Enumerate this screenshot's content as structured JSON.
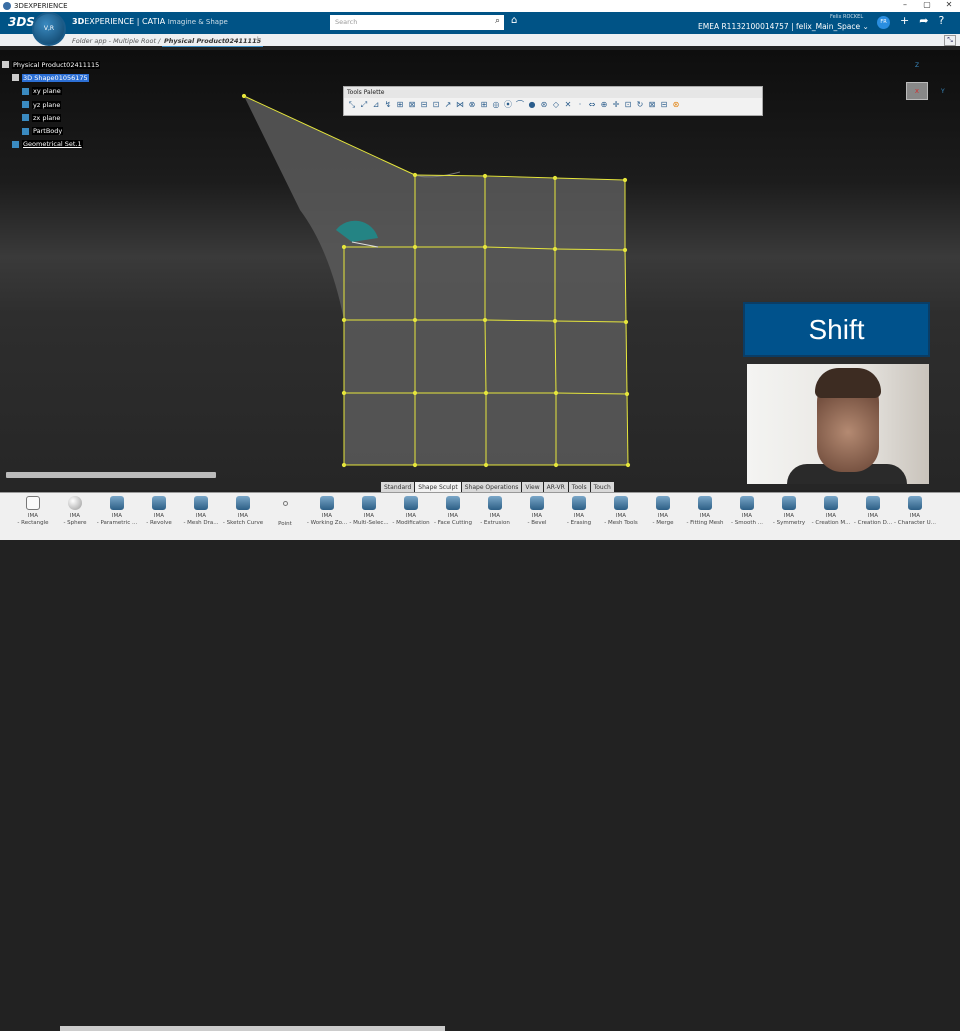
{
  "window": {
    "title": "3DEXPERIENCE",
    "controls": [
      "–",
      "▢",
      "✕"
    ]
  },
  "topbar": {
    "ds_logo": "3DS",
    "compass": "V,R",
    "brand_bold": "3D",
    "brand_rest": "EXPERIENCE | CATIA",
    "app": "Imagine & Shape",
    "search_placeholder": "Search",
    "user_name": "Felix ROCKEL",
    "context": "EMEA R1132100014757 | felix_Main_Space ⌄",
    "avatar": "FR"
  },
  "tabbar": {
    "breadcrumb": "Folder app - Multiple Root /",
    "active_tab": "Physical Product02411115"
  },
  "tree": [
    {
      "label": "Physical Product02411115",
      "icon": "product-icon"
    },
    {
      "label": "3D Shape01056175",
      "icon": "shape-icon",
      "selected": true
    },
    {
      "label": "xy plane",
      "icon": "plane-icon"
    },
    {
      "label": "yz plane",
      "icon": "plane-icon"
    },
    {
      "label": "zx plane",
      "icon": "plane-icon"
    },
    {
      "label": "PartBody",
      "icon": "partbody-icon"
    },
    {
      "label": "Geometrical Set.1",
      "icon": "geoset-icon"
    }
  ],
  "palette": {
    "title": "Tools Palette",
    "icons": [
      "⤡",
      "⤢",
      "⊿",
      "↯",
      "⊞",
      "⊠",
      "⊟",
      "⊡",
      "↗",
      "⋈",
      "⊗",
      "⊞",
      "◎",
      "⦿",
      "⌒",
      "●",
      "⊛",
      "◇",
      "✕",
      "·",
      "⇔",
      "⊕",
      "✛",
      "⊡",
      "↻",
      "⊠",
      "⊟",
      "⊛"
    ]
  },
  "axis": {
    "z": "Z",
    "y": "Y",
    "x": "x"
  },
  "overlay": {
    "key": "Shift"
  },
  "ribbon_tabs": [
    "Standard",
    "Shape Sculpt",
    "Shape Operations",
    "View",
    "AR-VR",
    "Tools",
    "Touch"
  ],
  "ribbon_active": "Shape Sculpt",
  "ribbon": [
    {
      "top": "IMA",
      "label": "- Rectangle"
    },
    {
      "top": "IMA",
      "label": "- Sphere"
    },
    {
      "top": "IMA",
      "label": "- Parametric ..."
    },
    {
      "top": "IMA",
      "label": "- Revolve"
    },
    {
      "top": "IMA",
      "label": "- Mesh Dra..."
    },
    {
      "top": "IMA",
      "label": "- Sketch Curve"
    },
    {
      "top": "",
      "label": "Point"
    },
    {
      "top": "IMA",
      "label": "- Working Zo..."
    },
    {
      "top": "IMA",
      "label": "- Multi-Selec..."
    },
    {
      "top": "IMA",
      "label": "- Modification"
    },
    {
      "top": "IMA",
      "label": "- Face Cutting"
    },
    {
      "top": "IMA",
      "label": "- Extrusion"
    },
    {
      "top": "IMA",
      "label": "- Bevel"
    },
    {
      "top": "IMA",
      "label": "- Erasing"
    },
    {
      "top": "IMA",
      "label": "- Mesh Tools"
    },
    {
      "top": "IMA",
      "label": "- Merge"
    },
    {
      "top": "IMA",
      "label": "- Fitting Mesh"
    },
    {
      "top": "IMA",
      "label": "- Smooth ..."
    },
    {
      "top": "IMA",
      "label": "- Symmetry"
    },
    {
      "top": "IMA",
      "label": "- Creation M..."
    },
    {
      "top": "IMA",
      "label": "- Creation D..."
    },
    {
      "top": "IMA",
      "label": "- Character U..."
    }
  ],
  "colors": {
    "brand": "#005386",
    "mesh": "#e6e63c",
    "selection": "#2c6fd4"
  }
}
